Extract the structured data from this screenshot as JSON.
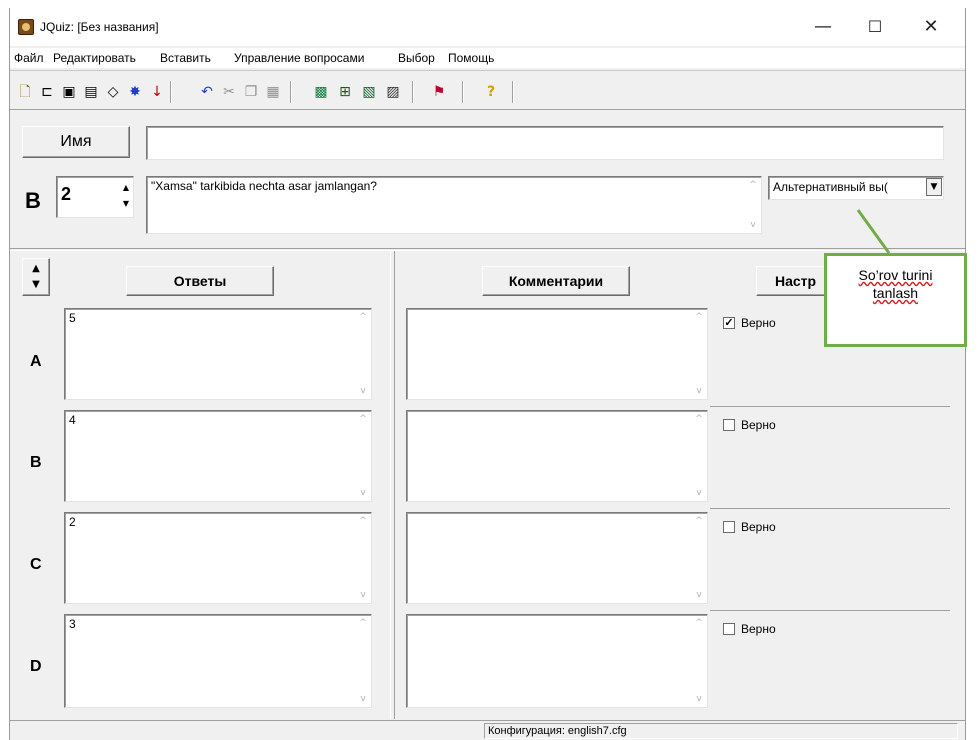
{
  "window": {
    "title": "JQuiz: [Без названия]"
  },
  "menu": [
    "Файл",
    "Редактировать",
    "Вставить",
    "Управление вопросами",
    "Выбор",
    "Помощь"
  ],
  "name_section": {
    "button_label": "Имя",
    "value": ""
  },
  "question": {
    "label": "В",
    "number": "2",
    "text": "\"Xamsa\" tarkibida nechta asar jamlangan?",
    "type_selected": "Альтернативный вы("
  },
  "headers": {
    "answers": "Ответы",
    "comments": "Комментарии",
    "settings": "Настр"
  },
  "answers": [
    {
      "letter": "A",
      "text": "5",
      "comment": "",
      "correct_label": "Верно",
      "checked": true
    },
    {
      "letter": "B",
      "text": "4",
      "comment": "",
      "correct_label": "Верно",
      "checked": false
    },
    {
      "letter": "C",
      "text": "2",
      "comment": "",
      "correct_label": "Верно",
      "checked": false
    },
    {
      "letter": "D",
      "text": "3",
      "comment": "",
      "correct_label": "Верно",
      "checked": false
    }
  ],
  "status": {
    "config": "Конфигурация: english7.cfg"
  },
  "callout": {
    "line1": "So’rov turini",
    "line2": "tanlash",
    "border_color": "#70ad47"
  },
  "icons": {
    "window": [
      "minimize-icon",
      "maximize-icon",
      "close-icon"
    ],
    "toolbar": [
      "new-file-icon",
      "open-folder-icon",
      "save-icon",
      "save-as-icon",
      "clear-icon",
      "web-export-icon",
      "down-arrow-icon",
      "undo-icon",
      "cut-icon",
      "copy-icon",
      "paste-icon",
      "add-question-icon",
      "export-icon",
      "image-icon",
      "image-edit-icon",
      "flag-icon",
      "help-icon"
    ]
  }
}
